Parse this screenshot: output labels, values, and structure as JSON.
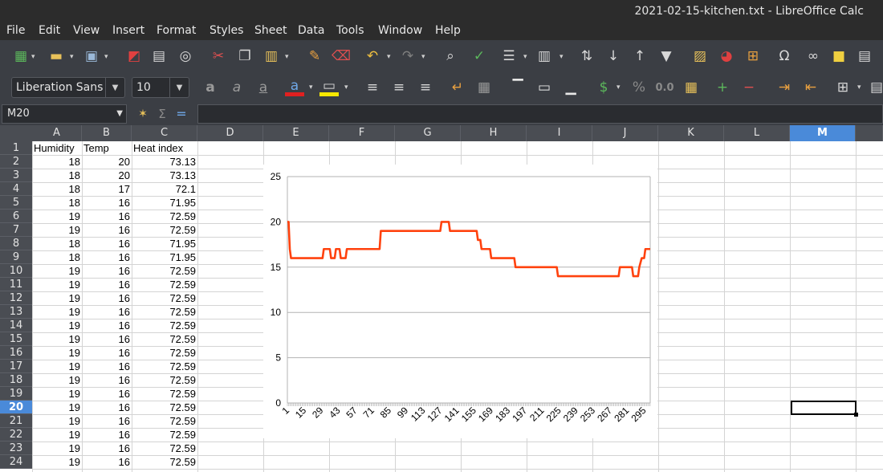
{
  "window": {
    "title": "2021-02-15-kitchen.txt - LibreOffice Calc"
  },
  "menu": [
    "File",
    "Edit",
    "View",
    "Insert",
    "Format",
    "Styles",
    "Sheet",
    "Data",
    "Tools",
    "Window",
    "Help"
  ],
  "font": {
    "name": "Liberation Sans",
    "size": "10"
  },
  "name_box": "M20",
  "formula": "",
  "columns": [
    "A",
    "B",
    "C",
    "D",
    "E",
    "F",
    "G",
    "H",
    "I",
    "J",
    "K",
    "L",
    "M"
  ],
  "selected_column": "M",
  "selected_row": 20,
  "rows": [
    {
      "n": "1",
      "a": "Humidity",
      "b": "Temp",
      "c": "Heat index"
    },
    {
      "n": "2",
      "a": "18",
      "b": "20",
      "c": "73.13"
    },
    {
      "n": "3",
      "a": "18",
      "b": "20",
      "c": "73.13"
    },
    {
      "n": "4",
      "a": "18",
      "b": "17",
      "c": "72.1"
    },
    {
      "n": "5",
      "a": "18",
      "b": "16",
      "c": "71.95"
    },
    {
      "n": "6",
      "a": "19",
      "b": "16",
      "c": "72.59"
    },
    {
      "n": "7",
      "a": "19",
      "b": "16",
      "c": "72.59"
    },
    {
      "n": "8",
      "a": "18",
      "b": "16",
      "c": "71.95"
    },
    {
      "n": "9",
      "a": "18",
      "b": "16",
      "c": "71.95"
    },
    {
      "n": "10",
      "a": "19",
      "b": "16",
      "c": "72.59"
    },
    {
      "n": "11",
      "a": "19",
      "b": "16",
      "c": "72.59"
    },
    {
      "n": "12",
      "a": "19",
      "b": "16",
      "c": "72.59"
    },
    {
      "n": "13",
      "a": "19",
      "b": "16",
      "c": "72.59"
    },
    {
      "n": "14",
      "a": "19",
      "b": "16",
      "c": "72.59"
    },
    {
      "n": "15",
      "a": "19",
      "b": "16",
      "c": "72.59"
    },
    {
      "n": "16",
      "a": "19",
      "b": "16",
      "c": "72.59"
    },
    {
      "n": "17",
      "a": "19",
      "b": "16",
      "c": "72.59"
    },
    {
      "n": "18",
      "a": "19",
      "b": "16",
      "c": "72.59"
    },
    {
      "n": "19",
      "a": "19",
      "b": "16",
      "c": "72.59"
    },
    {
      "n": "20",
      "a": "19",
      "b": "16",
      "c": "72.59"
    },
    {
      "n": "21",
      "a": "19",
      "b": "16",
      "c": "72.59"
    },
    {
      "n": "22",
      "a": "19",
      "b": "16",
      "c": "72.59"
    },
    {
      "n": "23",
      "a": "19",
      "b": "16",
      "c": "72.59"
    },
    {
      "n": "24",
      "a": "19",
      "b": "16",
      "c": "72.59"
    }
  ],
  "colors": {
    "series": "#ff420e",
    "selection": "#4a8ad9",
    "toolbar_bg": "#3b3e44"
  },
  "toolbar_icons": [
    "new-spreadsheet",
    "open",
    "save",
    "export-pdf",
    "print",
    "print-preview",
    "cut",
    "copy",
    "paste",
    "clone-formatting",
    "clear-formatting",
    "undo",
    "redo",
    "find-replace",
    "spelling",
    "rows",
    "columns",
    "sort",
    "sort-descending",
    "sort-ascending",
    "autofilter",
    "image",
    "chart",
    "pivot-table",
    "special-character",
    "hyperlink",
    "comment",
    "headers-footers"
  ],
  "chart_data": {
    "type": "line",
    "title": "",
    "xlabel": "",
    "ylabel": "",
    "ylim": [
      0,
      25
    ],
    "yticks": [
      0,
      5,
      10,
      15,
      20,
      25
    ],
    "xtick_labels": [
      "1",
      "15",
      "29",
      "43",
      "57",
      "71",
      "85",
      "99",
      "113",
      "127",
      "141",
      "155",
      "169",
      "183",
      "197",
      "211",
      "225",
      "239",
      "253",
      "267",
      "281",
      "295"
    ],
    "xlim": [
      1,
      300
    ],
    "grid": "horizontal",
    "legend": "right",
    "series": [
      {
        "name": "Temp",
        "color": "#ff420e",
        "points": [
          [
            1,
            20
          ],
          [
            2,
            20
          ],
          [
            3,
            17
          ],
          [
            4,
            16
          ],
          [
            30,
            16
          ],
          [
            31,
            17
          ],
          [
            36,
            17
          ],
          [
            37,
            16
          ],
          [
            40,
            16
          ],
          [
            41,
            17
          ],
          [
            44,
            17
          ],
          [
            45,
            16
          ],
          [
            49,
            16
          ],
          [
            50,
            17
          ],
          [
            77,
            17
          ],
          [
            78,
            19
          ],
          [
            127,
            19
          ],
          [
            128,
            20
          ],
          [
            134,
            20
          ],
          [
            135,
            19
          ],
          [
            157,
            19
          ],
          [
            158,
            18
          ],
          [
            160,
            18
          ],
          [
            161,
            17
          ],
          [
            168,
            17
          ],
          [
            169,
            16
          ],
          [
            188,
            16
          ],
          [
            189,
            15
          ],
          [
            223,
            15
          ],
          [
            224,
            14
          ],
          [
            274,
            14
          ],
          [
            275,
            15
          ],
          [
            285,
            15
          ],
          [
            286,
            14
          ],
          [
            290,
            14
          ],
          [
            291,
            15
          ],
          [
            293,
            16
          ],
          [
            295,
            16
          ],
          [
            296,
            17
          ],
          [
            300,
            17
          ]
        ]
      }
    ]
  }
}
